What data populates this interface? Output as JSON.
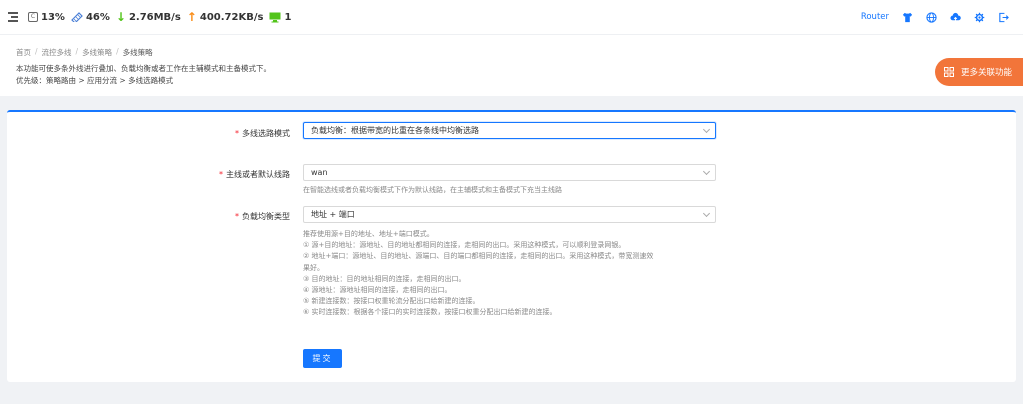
{
  "topbar": {
    "cpu": "13%",
    "cpu_icon_label": "C",
    "memory": "46%",
    "download": "2.76MB/s",
    "upload": "400.72KB/s",
    "devices": "1",
    "router_label": "Router",
    "icons": [
      "shirt-icon",
      "globe-icon",
      "cloud-upload-icon",
      "gear-icon",
      "logout-icon"
    ]
  },
  "breadcrumb": {
    "items": [
      "首页",
      "流控多线",
      "多线策略"
    ],
    "current": "多线策略",
    "separator": "/"
  },
  "description": {
    "line1": "本功能可使多条外线进行叠加、负载均衡或者工作在主辅模式和主备模式下。",
    "line2": "优先级：策略路由 > 应用分流 > 多线选路模式"
  },
  "more_button": "更多关联功能",
  "form": {
    "mode": {
      "label": "多线选路模式",
      "value": "负载均衡：根据带宽的比重在各条线中均衡选路"
    },
    "default_line": {
      "label": "主线或者默认线路",
      "value": "wan",
      "help": "在智能选线或者负载均衡模式下作为默认线路，在主辅模式和主备模式下充当主线路"
    },
    "balance_type": {
      "label": "负载均衡类型",
      "value": "地址 + 端口",
      "help_lines": [
        "推荐使用源+目的地址、地址+端口模式。",
        "① 源+目的地址：源地址、目的地址都相同的连接，走相同的出口。采用这种模式，可以顺利登录网银。",
        "② 地址+端口：源地址、目的地址、源端口、目的端口都相同的连接，走相同的出口。采用这种模式，带宽测速效",
        "果好。",
        "③ 目的地址：目的地址相同的连接，走相同的出口。",
        "④ 源地址：源地址相同的连接，走相同的出口。",
        "⑤ 新建连接数：按接口权重轮流分配出口给新建的连接。",
        "⑥ 实时连接数：根据各个接口的实时连接数，按接口权重分配出口给新建的连接。"
      ]
    },
    "submit_label": "提交"
  },
  "colors": {
    "primary": "#1677ff",
    "orange": "#f2753a",
    "download_green": "#52c41a",
    "upload_orange": "#fa8c16",
    "required_red": "#f5222d"
  }
}
